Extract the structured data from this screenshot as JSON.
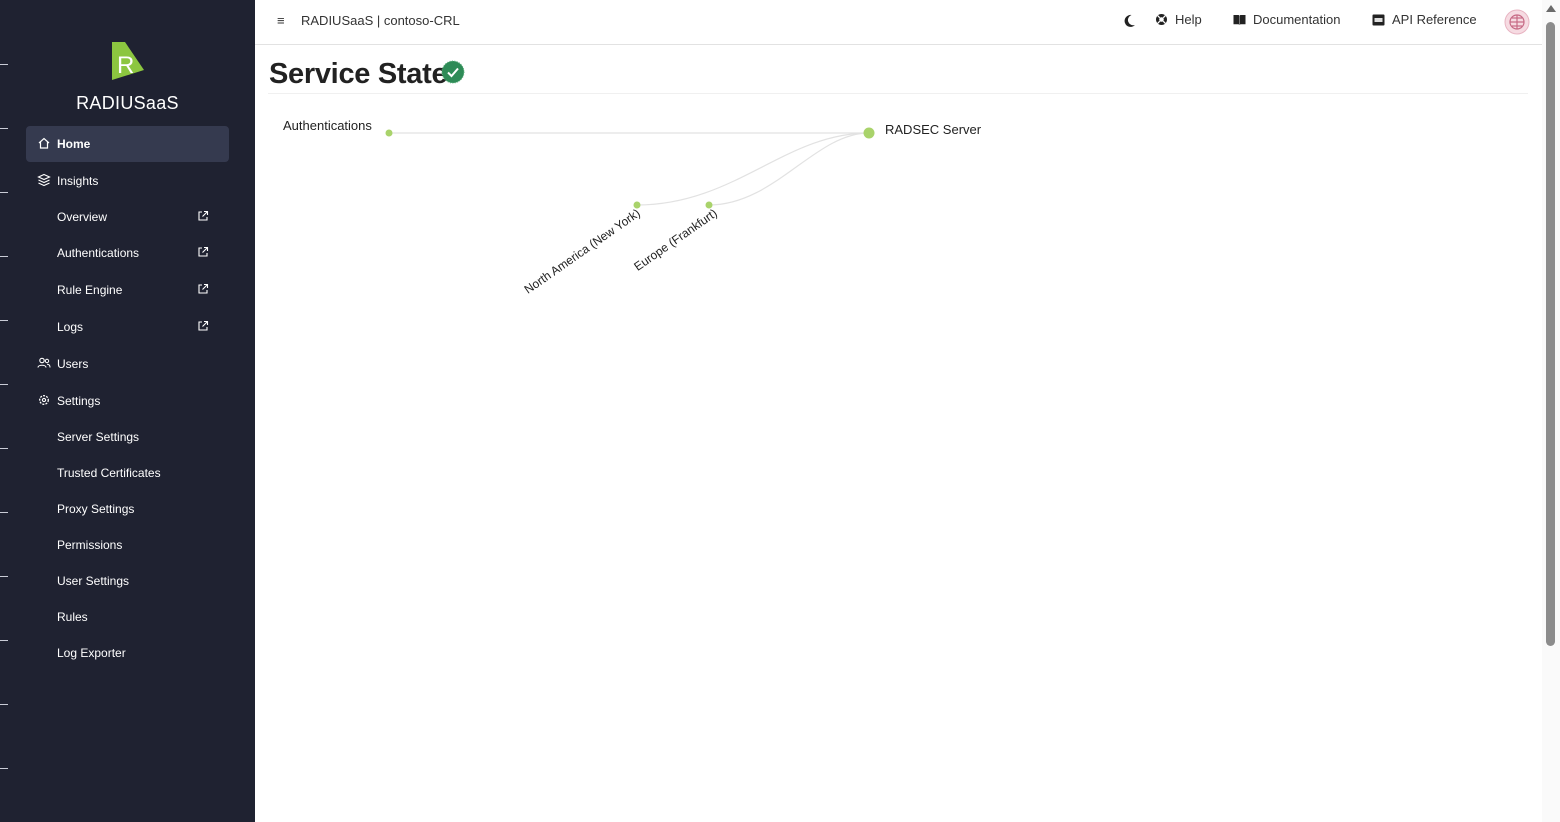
{
  "app": {
    "brand": "RADIUSaaS",
    "title": "RADIUSaaS | contoso-CRL"
  },
  "topbar": {
    "help": "Help",
    "documentation": "Documentation",
    "api_reference": "API Reference"
  },
  "sidebar": {
    "items": [
      {
        "label": "Home",
        "icon": "home-icon",
        "active": true
      },
      {
        "label": "Insights",
        "icon": "layers-icon"
      },
      {
        "label": "Overview",
        "external": true
      },
      {
        "label": "Authentications",
        "external": true
      },
      {
        "label": "Rule Engine",
        "external": true
      },
      {
        "label": "Logs",
        "external": true
      },
      {
        "label": "Users",
        "icon": "users-icon"
      },
      {
        "label": "Settings",
        "icon": "gear-icon"
      },
      {
        "label": "Server Settings"
      },
      {
        "label": "Trusted Certificates"
      },
      {
        "label": "Proxy Settings"
      },
      {
        "label": "Permissions"
      },
      {
        "label": "User Settings"
      },
      {
        "label": "Rules"
      },
      {
        "label": "Log Exporter"
      }
    ]
  },
  "main": {
    "title": "Service State",
    "status": "ok",
    "graph": {
      "source": "Authentications",
      "target": "RADSEC Server",
      "regions": [
        "North America (New York)",
        "Europe (Frankfurt)"
      ]
    }
  },
  "colors": {
    "sidebar_bg": "#1f2231",
    "active_bg": "#353a4f",
    "brand_green": "#8cc640",
    "node_green": "#a9d36b",
    "status_check": "#2e8b57"
  }
}
